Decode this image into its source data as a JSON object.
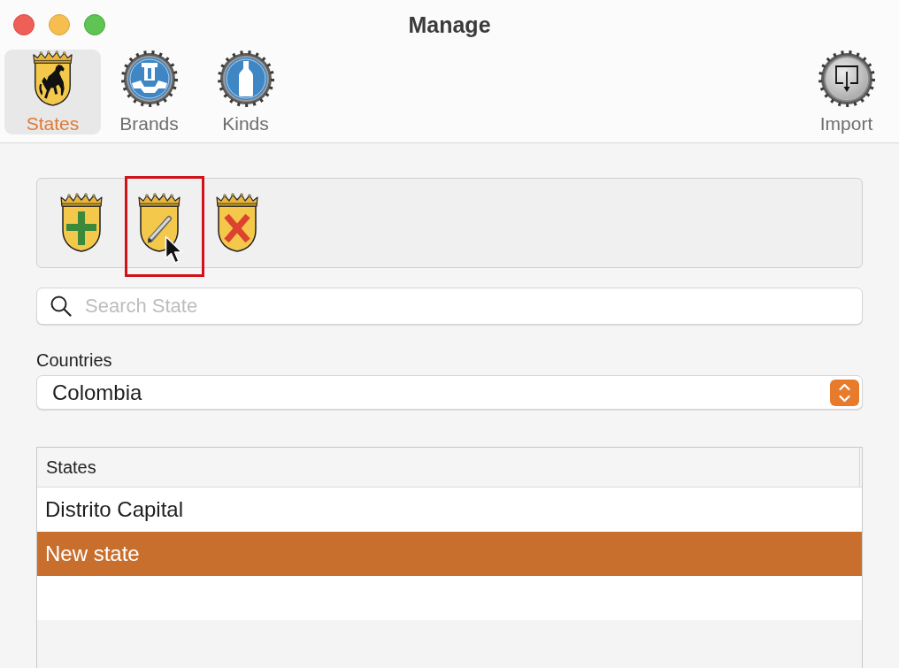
{
  "window": {
    "title": "Manage"
  },
  "toolbar": {
    "tabs": [
      {
        "kind": "shield",
        "label": "States",
        "selected": true
      },
      {
        "kind": "emblem",
        "label": "Brands",
        "selected": false
      },
      {
        "kind": "bottle",
        "label": "Kinds",
        "selected": false
      }
    ],
    "actions": [
      {
        "kind": "import",
        "label": "Import"
      }
    ]
  },
  "tools": [
    {
      "kind": "add",
      "highlighted": false,
      "hovered": false
    },
    {
      "kind": "edit",
      "highlighted": true,
      "hovered": true
    },
    {
      "kind": "delete",
      "highlighted": false,
      "hovered": false
    }
  ],
  "search": {
    "placeholder": "Search State"
  },
  "countries": {
    "label": "Countries",
    "value": "Colombia"
  },
  "table": {
    "columns": [
      "States"
    ],
    "rows": [
      {
        "cells": [
          "Distrito Capital"
        ],
        "selected": false
      },
      {
        "cells": [
          "New state"
        ],
        "selected": true
      }
    ]
  }
}
